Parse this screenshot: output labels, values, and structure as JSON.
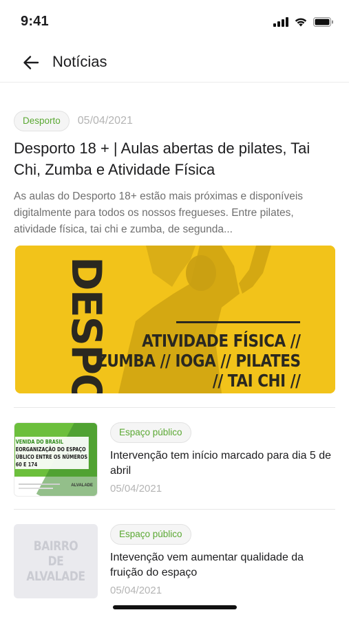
{
  "status_bar": {
    "time": "9:41"
  },
  "header": {
    "title": "Notícias",
    "back_icon": "arrow-left-icon"
  },
  "featured": {
    "tag": "Desporto",
    "date": "05/04/2021",
    "title": "Desporto 18 + | Aulas abertas de pilates, Tai Chi, Zumba e Atividade Física",
    "excerpt": "As aulas do Desporto 18+ estão mais próximas e disponíveis digitalmente para todos os nossos fregueses. Entre pilates, atividade física, tai chi e zumba, de segunda...",
    "image": {
      "vertical_text": "DESPORTO",
      "lines": [
        "ATIVIDADE FÍSICA //",
        "ZUMBA // IOGA // PILATES",
        "// TAI CHI //"
      ]
    }
  },
  "items": [
    {
      "tag": "Espaço público",
      "title": "Intervenção tem início marcado para dia 5 de abril",
      "date": "05/04/2021",
      "thumb": {
        "lines": [
          "VENIDA DO BRASIL",
          "EORGANIZAÇÃO DO ESPAÇO",
          "ÚBLICO ENTRE OS NÚMEROS",
          "60 E 174"
        ],
        "logo": "ALVALADE"
      }
    },
    {
      "tag": "Espaço público",
      "title": "Intevenção vem aumentar qualidade da fruição do espaço",
      "date": "05/04/2021",
      "thumb": {
        "lines": [
          "BAIRRO",
          "DE ALVALADE"
        ]
      }
    }
  ],
  "colors": {
    "tag_text": "#5aa832",
    "hero_bg": "#f2c31a",
    "date": "#b4b4b4"
  }
}
